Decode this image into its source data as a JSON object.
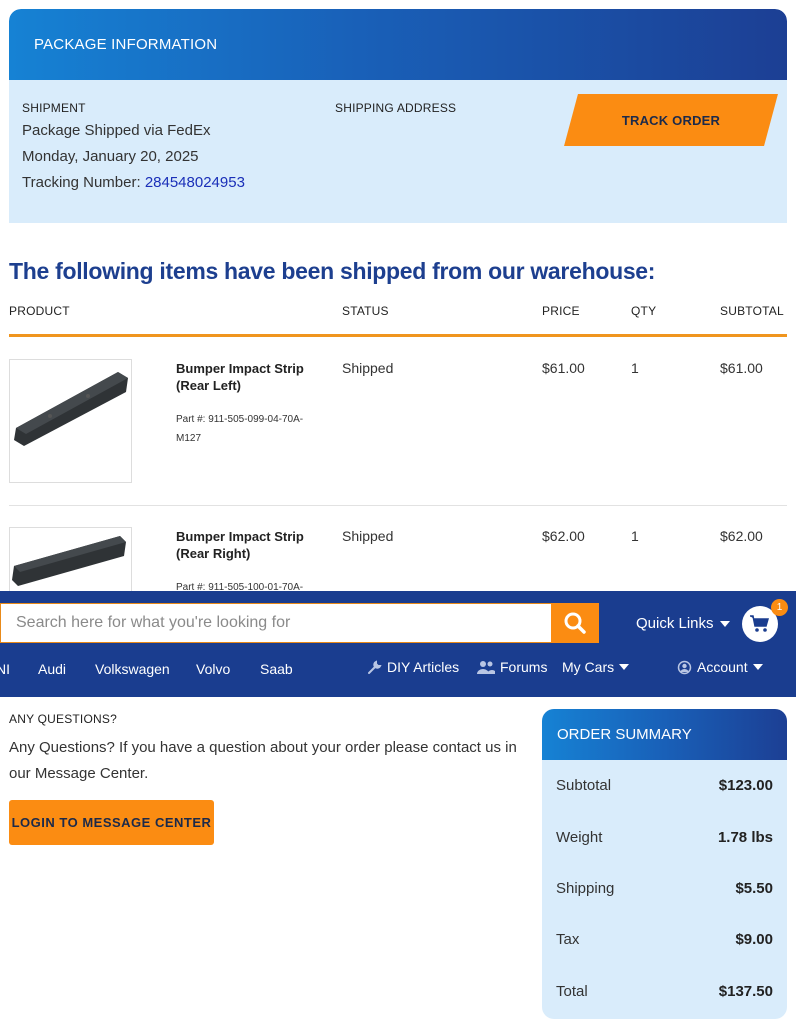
{
  "package": {
    "title": "PACKAGE INFORMATION",
    "shipment_label": "SHIPMENT",
    "shipping_address_label": "SHIPPING ADDRESS",
    "shipped_via": "Package Shipped via FedEx",
    "date": "Monday, January 20, 2025",
    "tracking_label": "Tracking Number: ",
    "tracking_number": "284548024953",
    "track_button": "TRACK ORDER"
  },
  "items_heading": "The following items have been shipped from our warehouse:",
  "table": {
    "headers": {
      "product": "PRODUCT",
      "status": "STATUS",
      "price": "PRICE",
      "qty": "QTY",
      "subtotal": "SUBTOTAL"
    },
    "rows": [
      {
        "name": "Bumper Impact Strip (Rear Left)",
        "part": "Part #: 911-505-099-04-70A-M127",
        "status": "Shipped",
        "price": "$61.00",
        "qty": "1",
        "subtotal": "$61.00"
      },
      {
        "name": "Bumper Impact Strip (Rear Right)",
        "part": "Part #: 911-505-100-01-70A-",
        "status": "Shipped",
        "price": "$62.00",
        "qty": "1",
        "subtotal": "$62.00"
      }
    ]
  },
  "nav": {
    "search_placeholder": "Search here for what you're looking for",
    "quick_links": "Quick Links",
    "cart_count": "1",
    "brands": [
      "NI",
      "Audi",
      "Volkswagen",
      "Volvo",
      "Saab"
    ],
    "diy": "DIY Articles",
    "forums": "Forums",
    "my_cars": "My Cars",
    "account": "Account"
  },
  "questions": {
    "label": "ANY QUESTIONS?",
    "text": "Any Questions? If you have a question about your order please contact us in our Message Center.",
    "button": "LOGIN TO MESSAGE CENTER"
  },
  "summary": {
    "title": "ORDER SUMMARY",
    "rows": [
      {
        "label": "Subtotal",
        "value": "$123.00"
      },
      {
        "label": "Weight",
        "value": "1.78 lbs"
      },
      {
        "label": "Shipping",
        "value": "$5.50"
      },
      {
        "label": "Tax",
        "value": "$9.00"
      },
      {
        "label": "Total",
        "value": "$137.50"
      }
    ]
  },
  "colors": {
    "brand_blue": "#1a3d8f",
    "accent_orange": "#fb8c12",
    "panel_blue": "#d9ecfb"
  }
}
